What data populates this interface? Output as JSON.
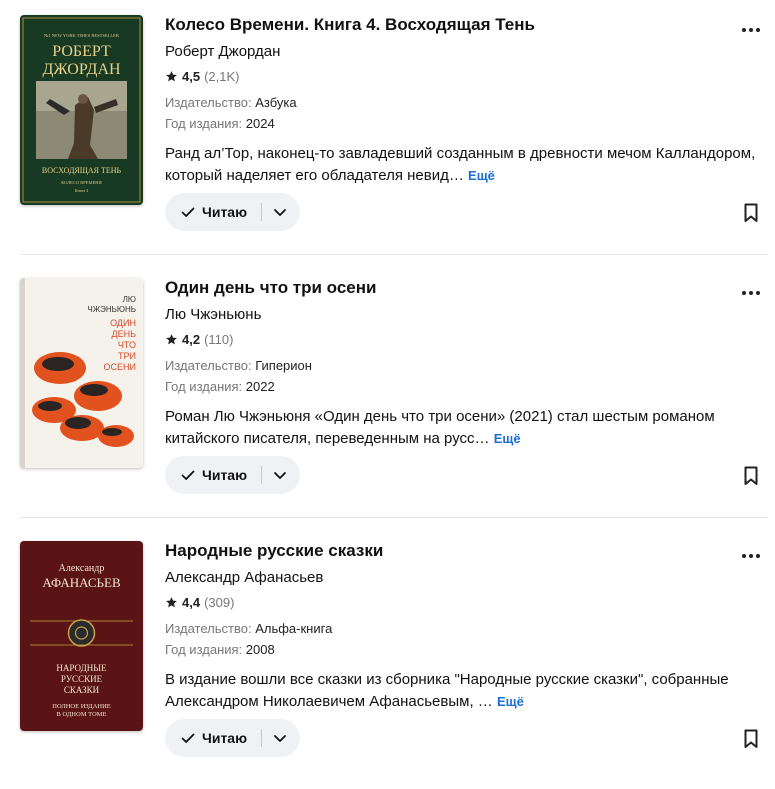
{
  "books": [
    {
      "title": "Колесо Времени. Книга 4. Восходящая Тень",
      "author": "Роберт Джордан",
      "rating": "4,5",
      "rating_count": "(2,1K)",
      "publisher_label": "Издательство:",
      "publisher": "Азбука",
      "year_label": "Год издания:",
      "year": "2024",
      "description": "Ранд ал’Тор, наконец-то завладевший созданным в древности мечом Калландором, который наделяет его обладателя невид… ",
      "more": "Ещё",
      "status": "Читаю",
      "cover": {
        "top_line": "№1 NEW YORK TIMES BESTSELLER",
        "author_line1": "РОБЕРТ",
        "author_line2": "ДЖОРДАН",
        "title": "ВОСХОДЯЩАЯ ТЕНЬ",
        "series": "КОЛЕСО ВРЕМЕНИ",
        "book_no": "Книга 4"
      }
    },
    {
      "title": "Один день что три осени",
      "author": "Лю Чжэньюнь",
      "rating": "4,2",
      "rating_count": "(110)",
      "publisher_label": "Издательство:",
      "publisher": "Гиперион",
      "year_label": "Год издания:",
      "year": "2022",
      "description": "Роман Лю Чжэньюня «Один день что три осени» (2021) стал шестым романом китайского писателя, переведенным на русс… ",
      "more": "Ещё",
      "status": "Читаю",
      "cover": {
        "author_line1": "ЛЮ",
        "author_line2": "ЧЖЭНЬЮНЬ",
        "t1": "ОДИН",
        "t2": "ДЕНЬ",
        "t3": "ЧТО",
        "t4": "ТРИ",
        "t5": "ОСЕНИ"
      }
    },
    {
      "title": "Народные русские сказки",
      "author": "Александр Афанасьев",
      "rating": "4,4",
      "rating_count": "(309)",
      "publisher_label": "Издательство:",
      "publisher": "Альфа-книга",
      "year_label": "Год издания:",
      "year": "2008",
      "description": "В издание вошли все сказки из сборника \"Народные русские сказки\", собранные Александром Николаевичем Афанасьевым, … ",
      "more": "Ещё",
      "status": "Читаю",
      "cover": {
        "author_line1": "Александр",
        "author_line2": "АФАНАСЬЕВ",
        "t1": "НАРОДНЫЕ",
        "t2": "РУССКИЕ",
        "t3": "СКАЗКИ",
        "s1": "ПОЛНОЕ ИЗДАНИЕ",
        "s2": "В ОДНОМ ТОМЕ"
      }
    }
  ],
  "colors": {
    "link": "#1c6fd6",
    "pill_bg": "#f0f1f4",
    "muted": "#777777"
  },
  "icons": [
    "star-icon",
    "check-icon",
    "chevron-down-icon",
    "more-options-icon",
    "bookmark-icon"
  ]
}
